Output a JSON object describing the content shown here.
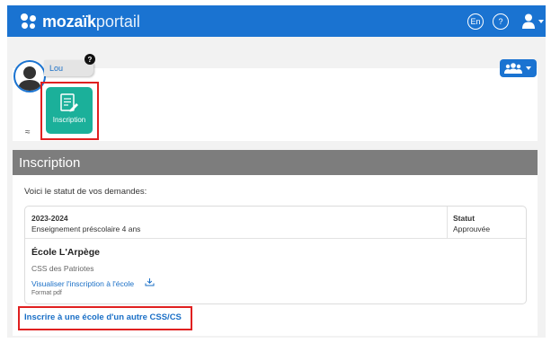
{
  "header": {
    "logo_bold": "mozaïk",
    "logo_light": "portail",
    "language_button": "En",
    "help_button": "?"
  },
  "profile": {
    "name": "Lou",
    "help_badge": "?"
  },
  "tiles": [
    {
      "label": "Inscription"
    }
  ],
  "collapse_glyph": "≈",
  "section": {
    "title": "Inscription",
    "intro": "Voici le statut de vos demandes:"
  },
  "request": {
    "year": "2023-2024",
    "program": "Enseignement préscolaire 4 ans",
    "status_header": "Statut",
    "status_value": "Approuvée",
    "school": "École L'Arpège",
    "service_center": "CSS des Patriotes",
    "view_link": "Visualiser l'inscription à l'école",
    "format": "Format pdf"
  },
  "other_school_link": "Inscrire à une école d'un autre CSS/CS",
  "colors": {
    "brand_blue": "#1a73d1",
    "tile_teal": "#1bb09a",
    "highlight_red": "#e02020",
    "section_header_gray": "#7d7d7d"
  },
  "icons": [
    "mozaik-logo-icon",
    "user-icon",
    "caret-down-icon",
    "group-icon",
    "edit-document-icon",
    "double-chevron-up-icon",
    "download-icon"
  ]
}
